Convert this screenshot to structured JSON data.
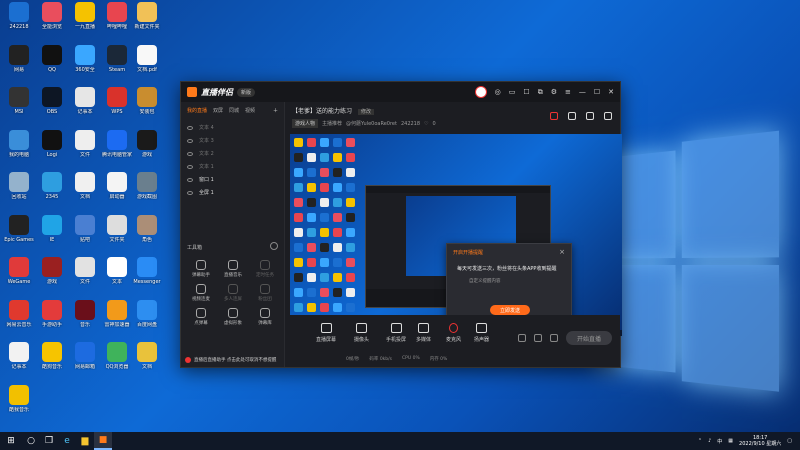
{
  "desktop": {
    "icons": [
      {
        "label": "242218",
        "color": "#1b6fd1"
      },
      {
        "label": "全能浏览",
        "color": "#e94e5d"
      },
      {
        "label": "一九直播",
        "color": "#f5c200"
      },
      {
        "label": "哔哩哔哩",
        "color": "#e8454f"
      },
      {
        "label": "新建文件夹",
        "color": "#f1c157"
      },
      {
        "label": "网易",
        "color": "#222"
      },
      {
        "label": "QQ",
        "color": "#111"
      },
      {
        "label": "360安全",
        "color": "#3aa7ff"
      },
      {
        "label": "Steam",
        "color": "#1b2838"
      },
      {
        "label": "文档.pdf",
        "color": "#f8f8f8"
      },
      {
        "label": "MSI",
        "color": "#333"
      },
      {
        "label": "OBS",
        "color": "#0d1624"
      },
      {
        "label": "记事本",
        "color": "#e6e6e6"
      },
      {
        "label": "WPS",
        "color": "#d9322b"
      },
      {
        "label": "安装包",
        "color": "#c98d2f"
      },
      {
        "label": "我的电脑",
        "color": "#3a8ed9"
      },
      {
        "label": "Logi",
        "color": "#111"
      },
      {
        "label": "文件",
        "color": "#eee"
      },
      {
        "label": "腾讯电脑管家",
        "color": "#1c6bf2"
      },
      {
        "label": "游戏",
        "color": "#1a1a1a"
      },
      {
        "label": "回收站",
        "color": "#94b2cc"
      },
      {
        "label": "2345",
        "color": "#2e9ee0"
      },
      {
        "label": "文档",
        "color": "#f0f0f0"
      },
      {
        "label": "启动器",
        "color": "#f4f4f4"
      },
      {
        "label": "游戏截图",
        "color": "#6a7f8e"
      },
      {
        "label": "Epic Games",
        "color": "#222"
      },
      {
        "label": "IE",
        "color": "#20a4e6"
      },
      {
        "label": "贴吧",
        "color": "#4a7fd2"
      },
      {
        "label": "文件夹",
        "color": "#ddd"
      },
      {
        "label": "角色",
        "color": "#ab8e77"
      },
      {
        "label": "WeGame",
        "color": "#e03a3a"
      },
      {
        "label": "游戏",
        "color": "#9a2020"
      },
      {
        "label": "文件",
        "color": "#e2e2e2"
      },
      {
        "label": "文本",
        "color": "#fff"
      },
      {
        "label": "Messenger",
        "color": "#2a8cf5"
      },
      {
        "label": "网易云音乐",
        "color": "#e0392e"
      },
      {
        "label": "手游助手",
        "color": "#e33b3b"
      },
      {
        "label": "音乐",
        "color": "#6a0f1a"
      },
      {
        "label": "雷神加速器",
        "color": "#f29a1a"
      },
      {
        "label": "百度网盘",
        "color": "#2d8ef0"
      },
      {
        "label": "记事本",
        "color": "#f2f2f2"
      },
      {
        "label": "酷狗音乐",
        "color": "#f6c400"
      },
      {
        "label": "网易邮箱",
        "color": "#1d6be0"
      },
      {
        "label": "QQ浏览器",
        "color": "#3fb35b"
      },
      {
        "label": "文档",
        "color": "#e9c23b"
      },
      {
        "label": "酷我音乐",
        "color": "#f2c000"
      }
    ]
  },
  "app": {
    "name": "直播伴侣",
    "version": "新版",
    "title_icons": [
      "耳机",
      "消息",
      "收藏",
      "窗口",
      "设置",
      "菜单",
      "最小化",
      "最大化",
      "关闭"
    ],
    "left_tabs": [
      "我的直播",
      "双屏",
      "同城",
      "视频"
    ],
    "scenes": [
      {
        "name": "文本 4",
        "lit": false
      },
      {
        "name": "文本 3",
        "lit": false
      },
      {
        "name": "文本 2",
        "lit": false
      },
      {
        "name": "文本 1",
        "lit": false
      },
      {
        "name": "窗口 1",
        "lit": true
      },
      {
        "name": "全屏 1",
        "lit": true
      }
    ],
    "tools_title": "工具箱",
    "tools": [
      {
        "label": "弹幕助手",
        "dim": false
      },
      {
        "label": "直播音乐",
        "dim": false
      },
      {
        "label": "定时任务",
        "dim": true
      },
      {
        "label": "视频连麦",
        "dim": false
      },
      {
        "label": "多人连屏",
        "dim": true
      },
      {
        "label": "粉丝团",
        "dim": true
      },
      {
        "label": "点弹幕",
        "dim": false
      },
      {
        "label": "虚拟形象",
        "dim": false
      },
      {
        "label": "弹幕库",
        "dim": false
      }
    ],
    "tip": "直播后直播助手 点击此处可取消不想提醒",
    "room": {
      "title": "【老爹】送的能力练习",
      "edit": "修改",
      "tag": "游戏人物",
      "category": "主播推荐",
      "streamer": "@何蘑Yule0oaRe0ret",
      "id": "242218",
      "likes": "0"
    },
    "modal": {
      "title": "开启开播提醒",
      "body": "每天可发送三次，粉丝将在头条APP收到提醒",
      "sub": "自定义提醒内容",
      "button": "立即发送"
    },
    "controls": [
      {
        "label": "直播屏幕"
      },
      {
        "label": "摄像头"
      },
      {
        "label": "手机投屏"
      },
      {
        "label": "多媒体"
      },
      {
        "label": "麦克风"
      },
      {
        "label": "扬声器"
      }
    ],
    "status": [
      "0帧/秒",
      "码率 0kb/s",
      "CPU 0%",
      "内存 0%"
    ],
    "start_button": "开始直播"
  },
  "taskbar": {
    "ime": "中",
    "clock_time": "18:17",
    "clock_date": "2022/9/10 星期六"
  }
}
